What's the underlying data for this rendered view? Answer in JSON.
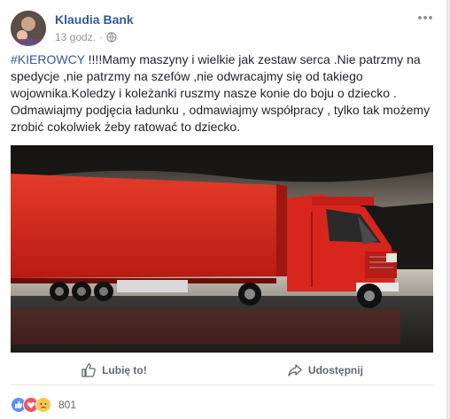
{
  "post": {
    "author": "Klaudia Bank",
    "time": "13 godz.",
    "hashtag": "#KIEROWCY",
    "text": " !!!!Mamy maszyny i wielkie jak zestaw serca .Nie patrzmy na spedycje ,nie patrzmy na szefów ,nie odwracajmy się od takiego wojownika.Koledzy i koleżanki ruszmy nasze konie do boju o dziecko . Odmawiajmy podjęcia ładunku , odmawiajmy współpracy , tylko tak możemy zrobić cokolwiek żeby ratować to dziecko."
  },
  "actions": {
    "like_label": "Lubię to!",
    "share_label": "Udostępnij"
  },
  "reactions": {
    "count": "801",
    "icons": [
      "like-icon",
      "love-icon",
      "sad-icon"
    ]
  },
  "colors": {
    "link": "#365899",
    "like_blue": "#5890ff",
    "love_red": "#f25268",
    "sad_yellow": "#f7c94b",
    "truck_red": "#d8261e"
  }
}
